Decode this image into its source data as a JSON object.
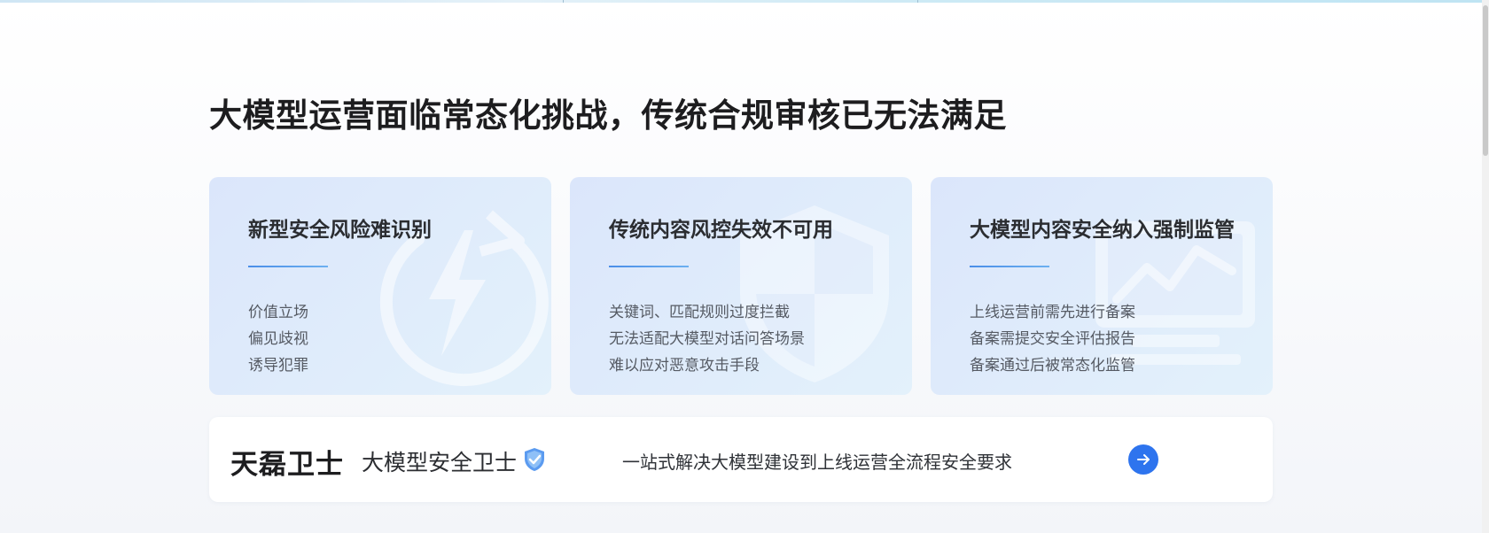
{
  "section": {
    "title": "大模型运营面临常态化挑战，传统合规审核已无法满足"
  },
  "cards": [
    {
      "title": "新型安全风险难识别",
      "icon": "lightning-circle-icon",
      "items": [
        "价值立场",
        "偏见歧视",
        "诱导犯罪"
      ]
    },
    {
      "title": "传统内容风控失效不可用",
      "icon": "shield-icon",
      "items": [
        "关键词、匹配规则过度拦截",
        "无法适配大模型对话问答场景",
        "难以应对恶意攻击手段"
      ]
    },
    {
      "title": "大模型内容安全纳入强制监管",
      "icon": "monitor-chart-icon",
      "items": [
        "上线运营前需先进行备案",
        "备案需提交安全评估报告",
        "备案通过后被常态化监管"
      ]
    }
  ],
  "banner": {
    "brand": "天磊卫士",
    "subbrand": "大模型安全卫士",
    "badge_icon": "shield-check-icon",
    "slogan": "一站式解决大模型建设到上线运营全流程安全要求",
    "action_icon": "arrow-right-icon"
  },
  "colors": {
    "accent": "#2e74ee",
    "card_bg_start": "#dbe6fb",
    "card_bg_end": "#e3f1fb",
    "title_text": "#1d1d1f"
  }
}
